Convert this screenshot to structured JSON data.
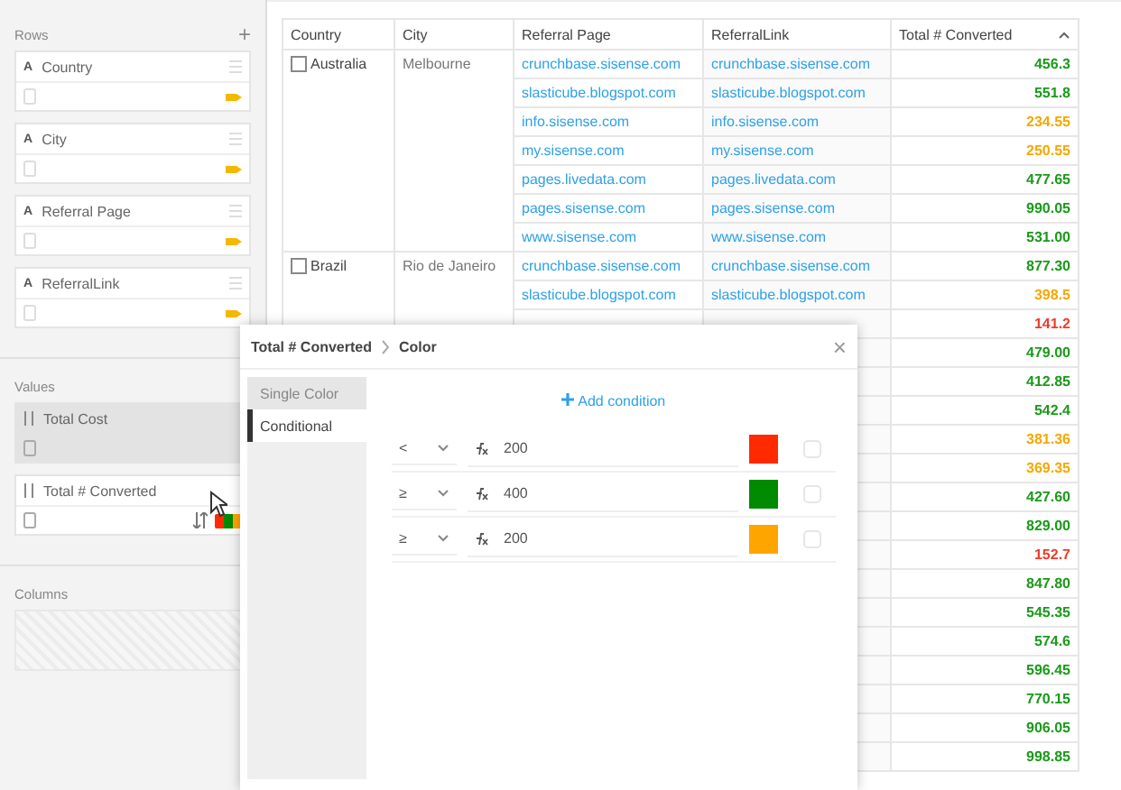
{
  "sidebar": {
    "rows_title": "Rows",
    "add_label": "+",
    "rows": [
      {
        "type": "A",
        "label": "Country"
      },
      {
        "type": "A",
        "label": "City"
      },
      {
        "type": "A",
        "label": "Referral Page"
      },
      {
        "type": "A",
        "label": "ReferralLink"
      }
    ],
    "values_title": "Values",
    "values": [
      {
        "label": "Total Cost",
        "selected": true,
        "colored": false
      },
      {
        "label": "Total # Converted",
        "selected": false,
        "colored": true
      }
    ],
    "columns_title": "Columns"
  },
  "table": {
    "columns": [
      "Country",
      "City",
      "Referral Page",
      "ReferralLink",
      "Total # Converted"
    ],
    "groups": [
      {
        "country": "Australia",
        "city": "Melbourne",
        "rows": [
          {
            "page": "crunchbase.sisense.com",
            "link": "crunchbase.sisense.com",
            "total": "456.3",
            "color": "#1a9a1a"
          },
          {
            "page": "slasticube.blogspot.com",
            "link": "slasticube.blogspot.com",
            "total": "551.8",
            "color": "#1a9a1a"
          },
          {
            "page": "info.sisense.com",
            "link": "info.sisense.com",
            "total": "234.55",
            "color": "#f5a800"
          },
          {
            "page": "my.sisense.com",
            "link": "my.sisense.com",
            "total": "250.55",
            "color": "#f5a800"
          },
          {
            "page": "pages.livedata.com",
            "link": "pages.livedata.com",
            "total": "477.65",
            "color": "#1a9a1a"
          },
          {
            "page": "pages.sisense.com",
            "link": "pages.sisense.com",
            "total": "990.05",
            "color": "#1a9a1a"
          },
          {
            "page": "www.sisense.com",
            "link": "www.sisense.com",
            "total": "531.00",
            "color": "#1a9a1a"
          }
        ]
      },
      {
        "country": "Brazil",
        "city": "Rio de Janeiro",
        "rows": [
          {
            "page": "crunchbase.sisense.com",
            "link": "crunchbase.sisense.com",
            "total": "877.30",
            "color": "#1a9a1a"
          },
          {
            "page": "slasticube.blogspot.com",
            "link": "slasticube.blogspot.com",
            "total": "398.5",
            "color": "#f5a800"
          },
          {
            "total": "141.2",
            "color": "#f03a2a"
          },
          {
            "total": "479.00",
            "color": "#1a9a1a"
          },
          {
            "total": "412.85",
            "color": "#1a9a1a"
          },
          {
            "total": "542.4",
            "color": "#1a9a1a"
          },
          {
            "total": "381.36",
            "color": "#f5a800"
          },
          {
            "total": "369.35",
            "color": "#f5a800"
          },
          {
            "total": "427.60",
            "color": "#1a9a1a"
          },
          {
            "total": "829.00",
            "color": "#1a9a1a"
          },
          {
            "total": "152.7",
            "color": "#f03a2a"
          },
          {
            "total": "847.80",
            "color": "#1a9a1a"
          },
          {
            "total": "545.35",
            "color": "#1a9a1a"
          },
          {
            "total": "574.6",
            "color": "#1a9a1a"
          },
          {
            "total": "596.45",
            "color": "#1a9a1a"
          },
          {
            "total": "770.15",
            "color": "#1a9a1a"
          },
          {
            "total": "906.05",
            "color": "#1a9a1a"
          },
          {
            "total": "998.85",
            "color": "#1a9a1a"
          }
        ]
      }
    ]
  },
  "dialog": {
    "title": "Total # Converted",
    "subtitle": "Color",
    "close": "×",
    "tabs": [
      {
        "label": "Single Color",
        "selected": false
      },
      {
        "label": "Conditional",
        "selected": true
      }
    ],
    "add_condition": "Add condition",
    "conditions": [
      {
        "operator": "<",
        "value": "200",
        "color": "#ff2a00"
      },
      {
        "operator": "≥",
        "value": "400",
        "color": "#008a00"
      },
      {
        "operator": "≥",
        "value": "200",
        "color": "#ffa500"
      }
    ]
  }
}
